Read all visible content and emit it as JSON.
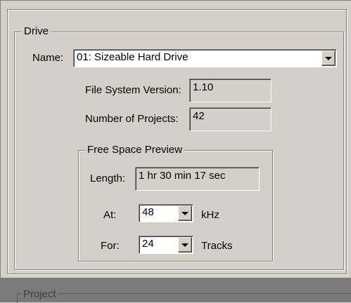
{
  "drive": {
    "group_label": "Drive",
    "name_label": "Name:",
    "name_value": "01: Sizeable Hard Drive",
    "fs_version_label": "File System Version:",
    "fs_version_value": "1.10",
    "num_projects_label": "Number of Projects:",
    "num_projects_value": "42"
  },
  "free_space": {
    "group_label": "Free Space Preview",
    "length_label": "Length:",
    "length_value": "1 hr 30 min 17 sec",
    "at_label": "At:",
    "at_value": "48",
    "at_unit": "kHz",
    "for_label": "For:",
    "for_value": "24",
    "for_unit": "Tracks"
  },
  "project": {
    "group_label": "Project"
  }
}
